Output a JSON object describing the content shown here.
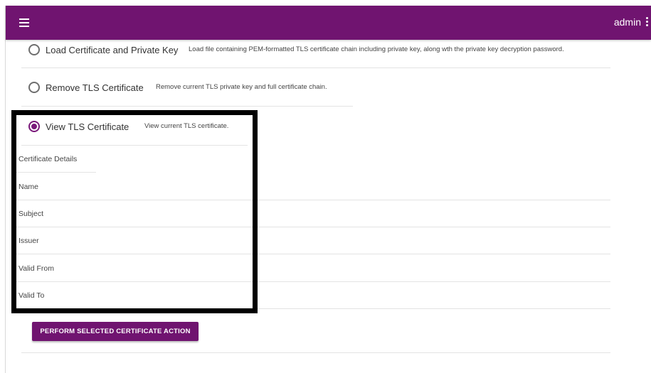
{
  "header": {
    "user": "admin"
  },
  "options": [
    {
      "label": "Load Certificate and Private Key",
      "description": "Load file containing PEM-formatted TLS certificate chain including private key, along wth the private key decryption password.",
      "selected": false
    },
    {
      "label": "Remove TLS Certificate",
      "description": "Remove current TLS private key and full certificate chain.",
      "selected": false
    },
    {
      "label": "View TLS Certificate",
      "description": "View current TLS certificate.",
      "selected": true
    }
  ],
  "details": {
    "heading": "Certificate Details",
    "fields": [
      "Name",
      "Subject",
      "Issuer",
      "Valid From",
      "Valid To"
    ]
  },
  "action": {
    "button_label": "PERFORM SELECTED CERTIFICATE ACTION"
  },
  "colors": {
    "brand": "#701470",
    "radio_selected": "#7a1a7a"
  },
  "icons": {
    "menu": "hamburger-menu-icon",
    "more": "kebab-menu-icon"
  }
}
